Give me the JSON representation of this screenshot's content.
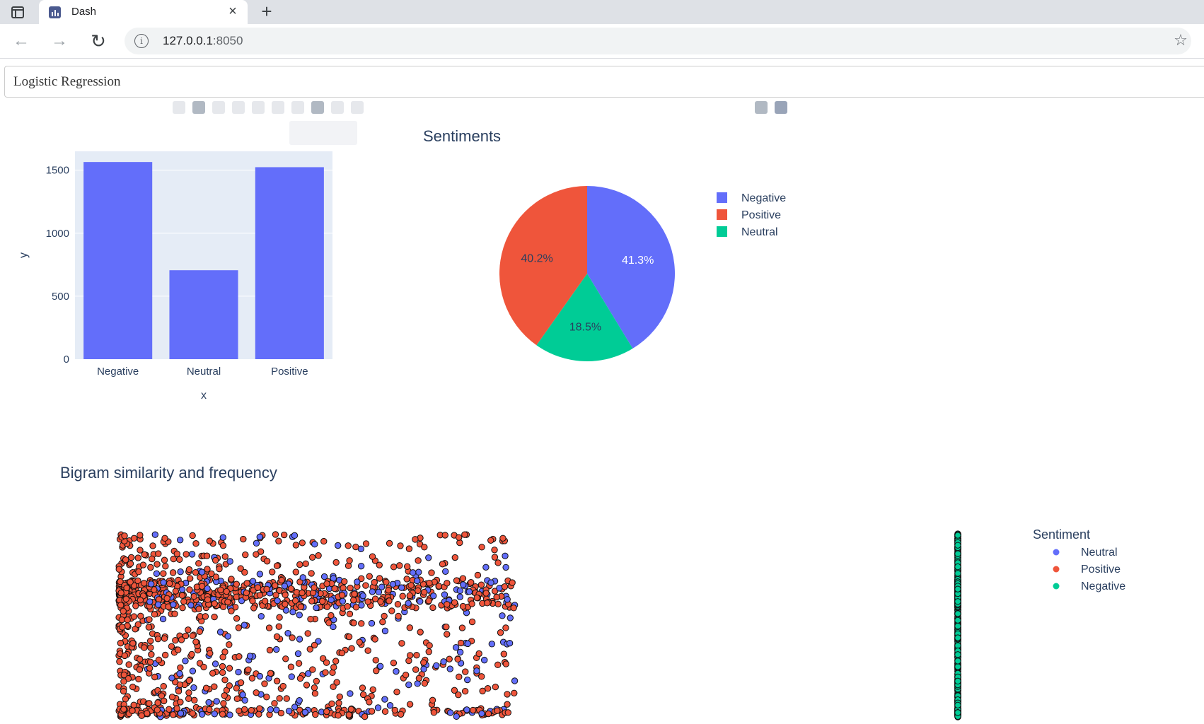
{
  "browser": {
    "tab_title": "Dash",
    "tab_close": "×",
    "new_tab": "+",
    "url_host": "127.0.0.1",
    "url_port": ":8050"
  },
  "dropdown": {
    "selected": "Logistic Regression"
  },
  "colors": {
    "negative_blue": "#636efa",
    "positive_red": "#ef553b",
    "neutral_green": "#00cc96",
    "plot_bg": "#e5ecf6",
    "text": "#2a3f5f"
  },
  "bar_chart": {
    "chart_data": {
      "type": "bar",
      "categories": [
        "Negative",
        "Neutral",
        "Positive"
      ],
      "values": [
        1565,
        706,
        1524
      ],
      "xlabel": "x",
      "ylabel": "y",
      "ylim": [
        0,
        1650
      ],
      "yticks": [
        0,
        500,
        1000,
        1500
      ],
      "grid": true
    }
  },
  "pie_chart": {
    "title": "Sentiments",
    "chart_data": {
      "type": "pie",
      "labels": [
        "Negative",
        "Neutral",
        "Positive"
      ],
      "values": [
        41.3,
        18.5,
        40.2
      ],
      "value_labels": [
        "41.3%",
        "18.5%",
        "40.2%"
      ],
      "legend_order": [
        "Negative",
        "Positive",
        "Neutral"
      ],
      "legend_placement": "right"
    }
  },
  "scatter_chart": {
    "title": "Bigram similarity and frequency",
    "legend_title": "Sentiment",
    "legend_items": [
      "Neutral",
      "Positive",
      "Negative"
    ],
    "chart_data": {
      "type": "scatter",
      "series": [
        {
          "name": "Neutral",
          "x_range": [
            0,
            0.5
          ],
          "density_peak": 0.2
        },
        {
          "name": "Positive",
          "x_range": [
            0,
            0.55
          ],
          "density_peak": 0.0
        },
        {
          "name": "Negative",
          "x_range": [
            0.35,
            1.0
          ],
          "density_peak": 1.0
        }
      ],
      "note_axes_visible": false
    }
  }
}
